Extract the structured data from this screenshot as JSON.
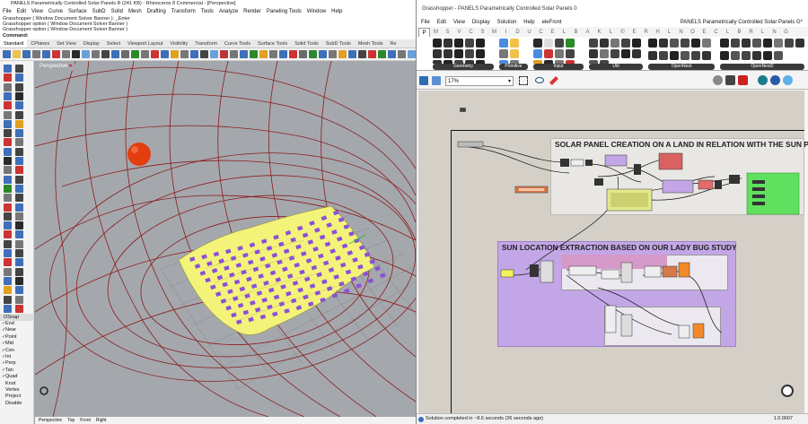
{
  "rhino": {
    "title": "PANELS Parametrically Controlled Solar Panels R (241 KB) - Rhinoceros 8 Commercial - [Perspective]",
    "menu": [
      "File",
      "Edit",
      "View",
      "Curve",
      "Surface",
      "SubD",
      "Solid",
      "Mesh",
      "Drafting",
      "Transform",
      "Tools",
      "Analyze",
      "Render",
      "Paneling Tools",
      "Window",
      "Help"
    ],
    "command_history": [
      "Grasshopper ( Window  Document  Solver  Banner ): _Enter",
      "Grasshopper option ( Window  Document  Solver  Banner )",
      "Grasshopper option ( Window  Document  Solver  Banner )"
    ],
    "command_prompt": "Command:",
    "tabs": [
      "Standard",
      "CPlanes",
      "Set View",
      "Display",
      "Select",
      "Viewport Layout",
      "Visibility",
      "Transform",
      "Curve Tools",
      "Surface Tools",
      "Solid Tools",
      "SubD Tools",
      "Mesh Tools",
      "Re"
    ],
    "active_tab": "Standard",
    "viewport_label": "Perspective",
    "osnap": {
      "title": "OSnap",
      "items": [
        {
          "label": "End",
          "checked": true
        },
        {
          "label": "Near",
          "checked": true
        },
        {
          "label": "Point",
          "checked": true
        },
        {
          "label": "Mid",
          "checked": true
        },
        {
          "label": "Cen",
          "checked": true
        },
        {
          "label": "Int",
          "checked": true
        },
        {
          "label": "Perp",
          "checked": true
        },
        {
          "label": "Tan",
          "checked": true
        },
        {
          "label": "Quad",
          "checked": true
        },
        {
          "label": "Knot",
          "checked": false
        },
        {
          "label": "Vertex",
          "checked": false
        },
        {
          "label": "Project",
          "checked": false
        },
        {
          "label": "Disable",
          "checked": false
        }
      ]
    },
    "view_tabs": [
      "Perspective",
      "Top",
      "Front",
      "Right"
    ]
  },
  "grasshopper": {
    "title": "Grasshopper - PANELS Parametrically Controlled Solar Panels 0",
    "menu": [
      "File",
      "Edit",
      "View",
      "Display",
      "Solution",
      "Help",
      "eleFront"
    ],
    "document_title": "PANELS Parametrically Controlled Solar Panels G*",
    "category_tabs": [
      "P",
      "M",
      "S",
      "V",
      "C",
      "S",
      "M",
      "I",
      "D",
      "U",
      "C",
      "E",
      "L",
      "B",
      "A",
      "K",
      "L",
      "©",
      "E",
      "R",
      "H",
      "L",
      "N",
      "O",
      "E",
      "C",
      "L",
      "B",
      "R",
      "L",
      "N",
      "G"
    ],
    "ribbon_groups": [
      "Geometry",
      "Primitive",
      "Input",
      "Util",
      "OpenNest",
      "OpenNest2"
    ],
    "zoom": "17%",
    "groups": [
      {
        "title": "SOLAR PANEL CREATION ON A LAND IN RELATION WITH THE SUN PO"
      },
      {
        "title": "SUN LOCATION EXTRACTION BASED ON OUR LADY BUG STUDY"
      }
    ],
    "status": "Solution completed in ~8.6 seconds (26 seconds ago)",
    "version": "1.0.0007"
  },
  "colors": {
    "viewport_bg": "#a4a8ad",
    "wire_red": "#8b1c1c",
    "surface": "#f3f379",
    "panel": "#8b4fd8",
    "sun": "#e43d10",
    "group_gray": "#e9e7e3",
    "group_purple": "#c3a6e6"
  }
}
